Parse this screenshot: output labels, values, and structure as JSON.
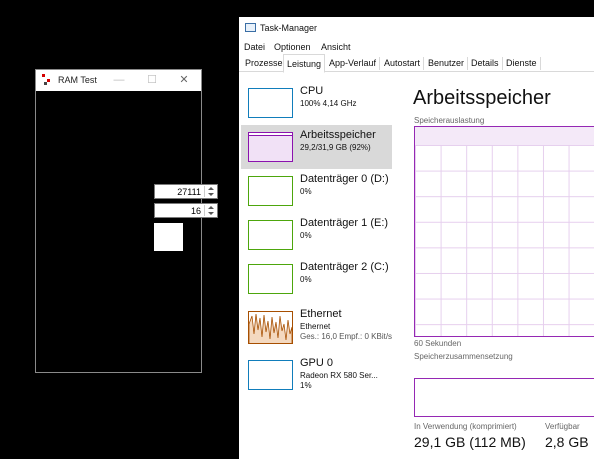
{
  "ram_test": {
    "title": "RAM Test",
    "minimize_icon": "—",
    "maximize_icon": "☐",
    "close_icon": "✕",
    "field1_value": "27111",
    "field2_value": "16"
  },
  "task_manager": {
    "title": "Task-Manager",
    "menu": [
      "Datei",
      "Optionen",
      "Ansicht"
    ],
    "tabs": [
      "Prozesse",
      "Leistung",
      "App-Verlauf",
      "Autostart",
      "Benutzer",
      "Details",
      "Dienste"
    ],
    "active_tab": "Leistung",
    "sidebar": [
      {
        "name": "CPU",
        "sub": "100% 4,14 GHz",
        "color": "#117dbb"
      },
      {
        "name": "Arbeitsspeicher",
        "sub": "29,2/31,9 GB (92%)",
        "color": "#8b12ae"
      },
      {
        "name": "Datenträger 0 (D:)",
        "sub": "0%",
        "color": "#4da60c"
      },
      {
        "name": "Datenträger 1 (E:)",
        "sub": "0%",
        "color": "#4da60c"
      },
      {
        "name": "Datenträger 2 (C:)",
        "sub": "0%",
        "color": "#4da60c"
      },
      {
        "name": "Ethernet",
        "sub": "Ethernet",
        "sub2": "Ges.: 16,0  Empf.: 0 KBit/s",
        "color": "#a74f01"
      },
      {
        "name": "GPU 0",
        "sub": "Radeon RX 580 Ser...",
        "sub2": "1%",
        "color": "#117dbb"
      }
    ],
    "detail": {
      "title": "Arbeitsspeicher",
      "usage_label": "Speicherauslastung",
      "time_label": "60 Sekunden",
      "composition_label": "Speicherzusammensetzung",
      "in_use_label": "In Verwendung (komprimiert)",
      "in_use_value": "29,1 GB (112 MB)",
      "available_label": "Verfügbar",
      "available_value": "2,8 GB",
      "memory_usage_fraction": 0.92
    }
  }
}
